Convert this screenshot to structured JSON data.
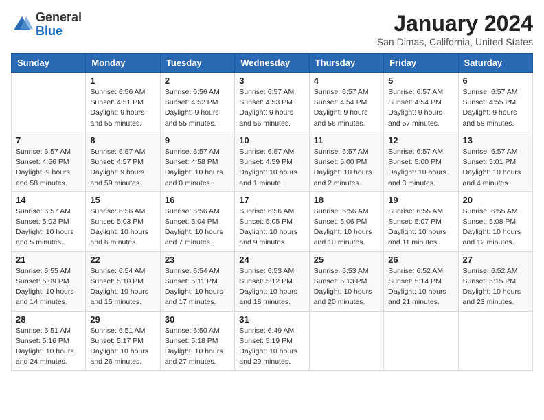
{
  "logo": {
    "general": "General",
    "blue": "Blue"
  },
  "title": "January 2024",
  "subtitle": "San Dimas, California, United States",
  "days_of_week": [
    "Sunday",
    "Monday",
    "Tuesday",
    "Wednesday",
    "Thursday",
    "Friday",
    "Saturday"
  ],
  "weeks": [
    [
      {
        "day": "",
        "info": ""
      },
      {
        "day": "1",
        "info": "Sunrise: 6:56 AM\nSunset: 4:51 PM\nDaylight: 9 hours\nand 55 minutes."
      },
      {
        "day": "2",
        "info": "Sunrise: 6:56 AM\nSunset: 4:52 PM\nDaylight: 9 hours\nand 55 minutes."
      },
      {
        "day": "3",
        "info": "Sunrise: 6:57 AM\nSunset: 4:53 PM\nDaylight: 9 hours\nand 56 minutes."
      },
      {
        "day": "4",
        "info": "Sunrise: 6:57 AM\nSunset: 4:54 PM\nDaylight: 9 hours\nand 56 minutes."
      },
      {
        "day": "5",
        "info": "Sunrise: 6:57 AM\nSunset: 4:54 PM\nDaylight: 9 hours\nand 57 minutes."
      },
      {
        "day": "6",
        "info": "Sunrise: 6:57 AM\nSunset: 4:55 PM\nDaylight: 9 hours\nand 58 minutes."
      }
    ],
    [
      {
        "day": "7",
        "info": "Sunrise: 6:57 AM\nSunset: 4:56 PM\nDaylight: 9 hours\nand 58 minutes."
      },
      {
        "day": "8",
        "info": "Sunrise: 6:57 AM\nSunset: 4:57 PM\nDaylight: 9 hours\nand 59 minutes."
      },
      {
        "day": "9",
        "info": "Sunrise: 6:57 AM\nSunset: 4:58 PM\nDaylight: 10 hours\nand 0 minutes."
      },
      {
        "day": "10",
        "info": "Sunrise: 6:57 AM\nSunset: 4:59 PM\nDaylight: 10 hours\nand 1 minute."
      },
      {
        "day": "11",
        "info": "Sunrise: 6:57 AM\nSunset: 5:00 PM\nDaylight: 10 hours\nand 2 minutes."
      },
      {
        "day": "12",
        "info": "Sunrise: 6:57 AM\nSunset: 5:00 PM\nDaylight: 10 hours\nand 3 minutes."
      },
      {
        "day": "13",
        "info": "Sunrise: 6:57 AM\nSunset: 5:01 PM\nDaylight: 10 hours\nand 4 minutes."
      }
    ],
    [
      {
        "day": "14",
        "info": "Sunrise: 6:57 AM\nSunset: 5:02 PM\nDaylight: 10 hours\nand 5 minutes."
      },
      {
        "day": "15",
        "info": "Sunrise: 6:56 AM\nSunset: 5:03 PM\nDaylight: 10 hours\nand 6 minutes."
      },
      {
        "day": "16",
        "info": "Sunrise: 6:56 AM\nSunset: 5:04 PM\nDaylight: 10 hours\nand 7 minutes."
      },
      {
        "day": "17",
        "info": "Sunrise: 6:56 AM\nSunset: 5:05 PM\nDaylight: 10 hours\nand 9 minutes."
      },
      {
        "day": "18",
        "info": "Sunrise: 6:56 AM\nSunset: 5:06 PM\nDaylight: 10 hours\nand 10 minutes."
      },
      {
        "day": "19",
        "info": "Sunrise: 6:55 AM\nSunset: 5:07 PM\nDaylight: 10 hours\nand 11 minutes."
      },
      {
        "day": "20",
        "info": "Sunrise: 6:55 AM\nSunset: 5:08 PM\nDaylight: 10 hours\nand 12 minutes."
      }
    ],
    [
      {
        "day": "21",
        "info": "Sunrise: 6:55 AM\nSunset: 5:09 PM\nDaylight: 10 hours\nand 14 minutes."
      },
      {
        "day": "22",
        "info": "Sunrise: 6:54 AM\nSunset: 5:10 PM\nDaylight: 10 hours\nand 15 minutes."
      },
      {
        "day": "23",
        "info": "Sunrise: 6:54 AM\nSunset: 5:11 PM\nDaylight: 10 hours\nand 17 minutes."
      },
      {
        "day": "24",
        "info": "Sunrise: 6:53 AM\nSunset: 5:12 PM\nDaylight: 10 hours\nand 18 minutes."
      },
      {
        "day": "25",
        "info": "Sunrise: 6:53 AM\nSunset: 5:13 PM\nDaylight: 10 hours\nand 20 minutes."
      },
      {
        "day": "26",
        "info": "Sunrise: 6:52 AM\nSunset: 5:14 PM\nDaylight: 10 hours\nand 21 minutes."
      },
      {
        "day": "27",
        "info": "Sunrise: 6:52 AM\nSunset: 5:15 PM\nDaylight: 10 hours\nand 23 minutes."
      }
    ],
    [
      {
        "day": "28",
        "info": "Sunrise: 6:51 AM\nSunset: 5:16 PM\nDaylight: 10 hours\nand 24 minutes."
      },
      {
        "day": "29",
        "info": "Sunrise: 6:51 AM\nSunset: 5:17 PM\nDaylight: 10 hours\nand 26 minutes."
      },
      {
        "day": "30",
        "info": "Sunrise: 6:50 AM\nSunset: 5:18 PM\nDaylight: 10 hours\nand 27 minutes."
      },
      {
        "day": "31",
        "info": "Sunrise: 6:49 AM\nSunset: 5:19 PM\nDaylight: 10 hours\nand 29 minutes."
      },
      {
        "day": "",
        "info": ""
      },
      {
        "day": "",
        "info": ""
      },
      {
        "day": "",
        "info": ""
      }
    ]
  ]
}
